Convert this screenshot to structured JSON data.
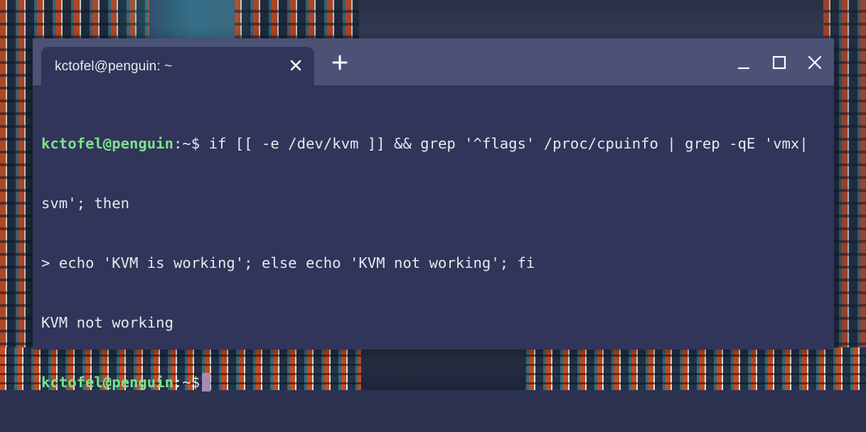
{
  "window": {
    "tab_title": "kctofel@penguin: ~",
    "tab_close_icon": "close-icon",
    "new_tab_icon": "plus-icon",
    "controls": [
      "minimize-icon",
      "maximize-icon",
      "close-icon"
    ]
  },
  "terminal": {
    "prompt_user": "kctofel@penguin",
    "prompt_path": ":~$",
    "lines": [
      {
        "kind": "prompt",
        "cmd": " if [[ -e /dev/kvm ]] && grep '^flags' /proc/cpuinfo | grep -qE 'vmx|"
      },
      {
        "kind": "text",
        "text": "svm'; then"
      },
      {
        "kind": "text",
        "text": "> echo 'KVM is working'; else echo 'KVM not working'; fi"
      },
      {
        "kind": "text",
        "text": "KVM not working"
      },
      {
        "kind": "prompt",
        "cmd": " "
      }
    ]
  },
  "colors": {
    "terminal_bg": "#313559",
    "titlebar_bg": "#4b5275",
    "prompt_user": "#7ee08a",
    "cursor": "#a58bb8"
  }
}
